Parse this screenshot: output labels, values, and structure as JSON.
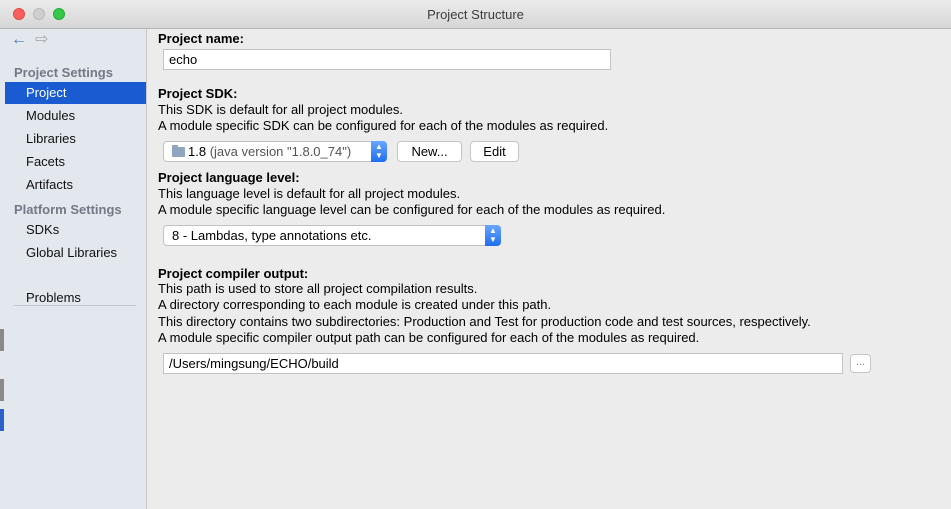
{
  "window": {
    "title": "Project Structure"
  },
  "sidebar": {
    "back_icon": "←",
    "forward_icon": "⇨",
    "project_settings_heading": "Project Settings",
    "project_items": [
      "Project",
      "Modules",
      "Libraries",
      "Facets",
      "Artifacts"
    ],
    "platform_settings_heading": "Platform Settings",
    "platform_items": [
      "SDKs",
      "Global Libraries"
    ],
    "problems": "Problems",
    "selected": "Project"
  },
  "main": {
    "project_name_label": "Project name:",
    "project_name_value": "echo",
    "sdk_label": "Project SDK:",
    "sdk_desc1": "This SDK is default for all project modules.",
    "sdk_desc2": "A module specific SDK can be configured for each of the modules as required.",
    "sdk_version": "1.8",
    "sdk_detail": "(java version \"1.8.0_74\")",
    "sdk_new_button": "New...",
    "sdk_edit_button": "Edit",
    "language_label": "Project language level:",
    "language_desc1": "This language level is default for all project modules.",
    "language_desc2": "A module specific language level can be configured for each of the modules as required.",
    "language_value": "8 - Lambdas, type annotations etc.",
    "output_label": "Project compiler output:",
    "output_desc1": "This path is used to store all project compilation results.",
    "output_desc2": "A directory corresponding to each module is created under this path.",
    "output_desc3": "This directory contains two subdirectories: Production and Test for production code and test sources, respectively.",
    "output_desc4": "A module specific compiler output path can be configured for each of the modules as required.",
    "output_path": "/Users/mingsung/ECHO/build",
    "browse_button": "..."
  },
  "colors": {
    "selection": "#1a5bd2",
    "combo_arrow": "#1e6ef0"
  }
}
